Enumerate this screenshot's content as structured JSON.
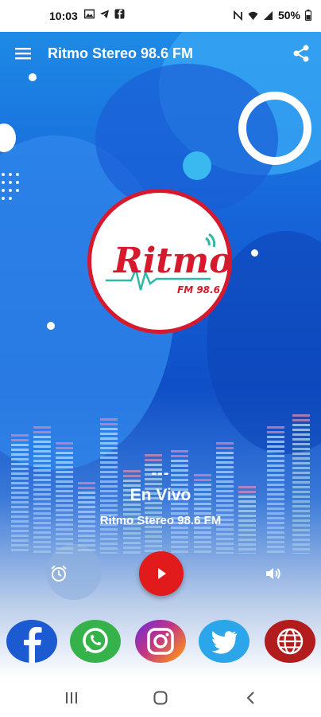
{
  "status_bar": {
    "time": "10:03",
    "battery": "50%"
  },
  "app_bar": {
    "title": "Ritmo Stereo 98.6 FM"
  },
  "logo": {
    "brand": "Ritmo",
    "sub": "FM 98.6"
  },
  "player": {
    "track": "---",
    "status": "En Vivo",
    "station": "Ritmo Stereo 98.6 FM"
  },
  "icons": {
    "menu": "hamburger-icon",
    "share": "share-icon",
    "alarm": "alarm-icon",
    "play": "play-icon",
    "volume": "volume-icon"
  },
  "social": [
    "facebook",
    "whatsapp",
    "instagram",
    "twitter",
    "web"
  ],
  "colors": {
    "accent": "#e11b1b",
    "logo_ring": "#d7192d",
    "background": "#1663d8"
  }
}
